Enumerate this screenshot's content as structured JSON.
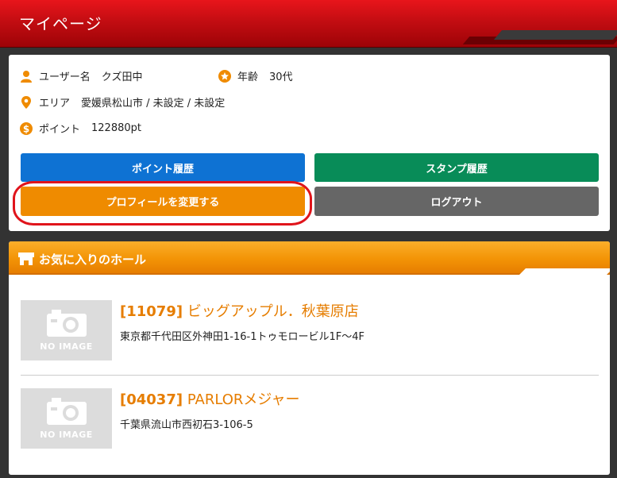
{
  "header": {
    "title": "マイページ"
  },
  "profile": {
    "username_label": "ユーザー名",
    "username_value": "クズ田中",
    "age_label": "年齢",
    "age_value": "30代",
    "area_label": "エリア",
    "area_value": "愛媛県松山市 /  未設定 /  未設定",
    "points_label": "ポイント",
    "points_value": "122880pt"
  },
  "buttons": {
    "point_history": "ポイント履歴",
    "stamp_history": "スタンプ履歴",
    "change_profile": "プロフィールを変更する",
    "logout": "ログアウト"
  },
  "favorites": {
    "title": "お気に入りのホール",
    "halls": [
      {
        "code": "[11079]",
        "name": "ビッグアップル．秋葉原店",
        "address": "東京都千代田区外神田1-16-1トゥモロービル1F～4F",
        "image_text": "NO IMAGE"
      },
      {
        "code": "[04037]",
        "name": "PARLORメジャー",
        "address": "千葉県流山市西初石3-106-5",
        "image_text": "NO IMAGE"
      }
    ]
  },
  "colors": {
    "header_red": "#c30d12",
    "accent_orange": "#ef8b00",
    "button_blue": "#0e72d3",
    "button_green": "#088c58",
    "button_gray": "#666666",
    "highlight_red": "#e0141b"
  }
}
